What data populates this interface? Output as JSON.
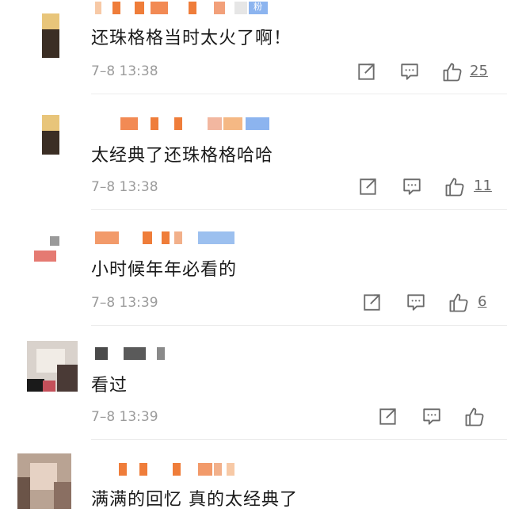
{
  "colors": {
    "text": "#1a1a1a",
    "meta": "#9b9b9b",
    "icon": "#6b6b6b",
    "divider": "#ececec"
  },
  "comments": [
    {
      "text": "还珠格格当时太火了啊！",
      "time": "7–8 13:38",
      "likes": "25"
    },
    {
      "text": "太经典了还珠格格哈哈",
      "time": "7–8 13:38",
      "likes": "11"
    },
    {
      "text": "小时候年年必看的",
      "time": "7–8 13:39",
      "likes": "6"
    },
    {
      "text": "看过",
      "time": "7–8 13:39",
      "likes": ""
    },
    {
      "text": "满满的回忆 真的太经典了",
      "time": "",
      "likes": ""
    }
  ],
  "icons": {
    "share": "share-icon",
    "comment": "comment-icon",
    "like": "thumbs-up-icon"
  },
  "badge": {
    "fans": "粉"
  }
}
